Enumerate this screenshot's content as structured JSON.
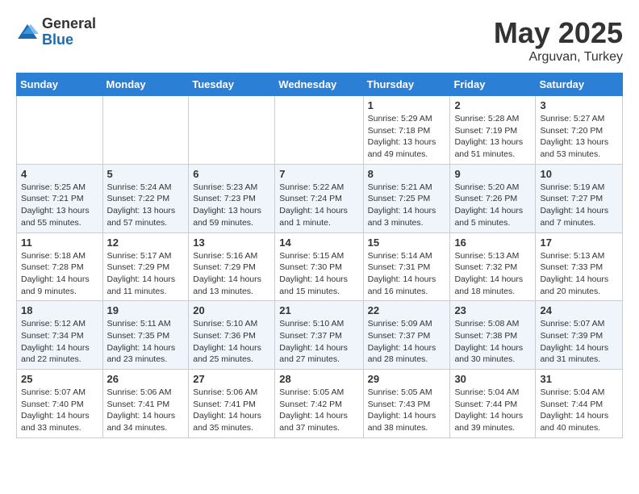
{
  "header": {
    "logo_general": "General",
    "logo_blue": "Blue",
    "month": "May 2025",
    "location": "Arguvan, Turkey"
  },
  "weekdays": [
    "Sunday",
    "Monday",
    "Tuesday",
    "Wednesday",
    "Thursday",
    "Friday",
    "Saturday"
  ],
  "weeks": [
    [
      {
        "day": "",
        "info": ""
      },
      {
        "day": "",
        "info": ""
      },
      {
        "day": "",
        "info": ""
      },
      {
        "day": "",
        "info": ""
      },
      {
        "day": "1",
        "info": "Sunrise: 5:29 AM\nSunset: 7:18 PM\nDaylight: 13 hours\nand 49 minutes."
      },
      {
        "day": "2",
        "info": "Sunrise: 5:28 AM\nSunset: 7:19 PM\nDaylight: 13 hours\nand 51 minutes."
      },
      {
        "day": "3",
        "info": "Sunrise: 5:27 AM\nSunset: 7:20 PM\nDaylight: 13 hours\nand 53 minutes."
      }
    ],
    [
      {
        "day": "4",
        "info": "Sunrise: 5:25 AM\nSunset: 7:21 PM\nDaylight: 13 hours\nand 55 minutes."
      },
      {
        "day": "5",
        "info": "Sunrise: 5:24 AM\nSunset: 7:22 PM\nDaylight: 13 hours\nand 57 minutes."
      },
      {
        "day": "6",
        "info": "Sunrise: 5:23 AM\nSunset: 7:23 PM\nDaylight: 13 hours\nand 59 minutes."
      },
      {
        "day": "7",
        "info": "Sunrise: 5:22 AM\nSunset: 7:24 PM\nDaylight: 14 hours\nand 1 minute."
      },
      {
        "day": "8",
        "info": "Sunrise: 5:21 AM\nSunset: 7:25 PM\nDaylight: 14 hours\nand 3 minutes."
      },
      {
        "day": "9",
        "info": "Sunrise: 5:20 AM\nSunset: 7:26 PM\nDaylight: 14 hours\nand 5 minutes."
      },
      {
        "day": "10",
        "info": "Sunrise: 5:19 AM\nSunset: 7:27 PM\nDaylight: 14 hours\nand 7 minutes."
      }
    ],
    [
      {
        "day": "11",
        "info": "Sunrise: 5:18 AM\nSunset: 7:28 PM\nDaylight: 14 hours\nand 9 minutes."
      },
      {
        "day": "12",
        "info": "Sunrise: 5:17 AM\nSunset: 7:29 PM\nDaylight: 14 hours\nand 11 minutes."
      },
      {
        "day": "13",
        "info": "Sunrise: 5:16 AM\nSunset: 7:29 PM\nDaylight: 14 hours\nand 13 minutes."
      },
      {
        "day": "14",
        "info": "Sunrise: 5:15 AM\nSunset: 7:30 PM\nDaylight: 14 hours\nand 15 minutes."
      },
      {
        "day": "15",
        "info": "Sunrise: 5:14 AM\nSunset: 7:31 PM\nDaylight: 14 hours\nand 16 minutes."
      },
      {
        "day": "16",
        "info": "Sunrise: 5:13 AM\nSunset: 7:32 PM\nDaylight: 14 hours\nand 18 minutes."
      },
      {
        "day": "17",
        "info": "Sunrise: 5:13 AM\nSunset: 7:33 PM\nDaylight: 14 hours\nand 20 minutes."
      }
    ],
    [
      {
        "day": "18",
        "info": "Sunrise: 5:12 AM\nSunset: 7:34 PM\nDaylight: 14 hours\nand 22 minutes."
      },
      {
        "day": "19",
        "info": "Sunrise: 5:11 AM\nSunset: 7:35 PM\nDaylight: 14 hours\nand 23 minutes."
      },
      {
        "day": "20",
        "info": "Sunrise: 5:10 AM\nSunset: 7:36 PM\nDaylight: 14 hours\nand 25 minutes."
      },
      {
        "day": "21",
        "info": "Sunrise: 5:10 AM\nSunset: 7:37 PM\nDaylight: 14 hours\nand 27 minutes."
      },
      {
        "day": "22",
        "info": "Sunrise: 5:09 AM\nSunset: 7:37 PM\nDaylight: 14 hours\nand 28 minutes."
      },
      {
        "day": "23",
        "info": "Sunrise: 5:08 AM\nSunset: 7:38 PM\nDaylight: 14 hours\nand 30 minutes."
      },
      {
        "day": "24",
        "info": "Sunrise: 5:07 AM\nSunset: 7:39 PM\nDaylight: 14 hours\nand 31 minutes."
      }
    ],
    [
      {
        "day": "25",
        "info": "Sunrise: 5:07 AM\nSunset: 7:40 PM\nDaylight: 14 hours\nand 33 minutes."
      },
      {
        "day": "26",
        "info": "Sunrise: 5:06 AM\nSunset: 7:41 PM\nDaylight: 14 hours\nand 34 minutes."
      },
      {
        "day": "27",
        "info": "Sunrise: 5:06 AM\nSunset: 7:41 PM\nDaylight: 14 hours\nand 35 minutes."
      },
      {
        "day": "28",
        "info": "Sunrise: 5:05 AM\nSunset: 7:42 PM\nDaylight: 14 hours\nand 37 minutes."
      },
      {
        "day": "29",
        "info": "Sunrise: 5:05 AM\nSunset: 7:43 PM\nDaylight: 14 hours\nand 38 minutes."
      },
      {
        "day": "30",
        "info": "Sunrise: 5:04 AM\nSunset: 7:44 PM\nDaylight: 14 hours\nand 39 minutes."
      },
      {
        "day": "31",
        "info": "Sunrise: 5:04 AM\nSunset: 7:44 PM\nDaylight: 14 hours\nand 40 minutes."
      }
    ]
  ]
}
